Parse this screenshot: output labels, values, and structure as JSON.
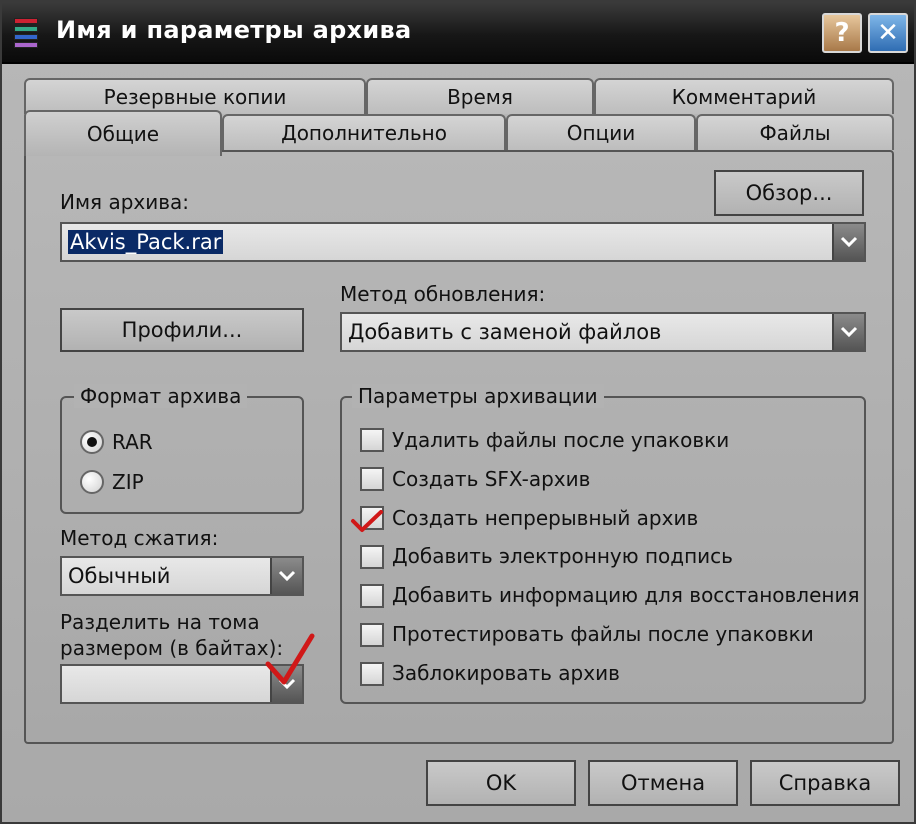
{
  "window": {
    "title": "Имя и параметры архива",
    "help_button": "?",
    "close_button": "✕"
  },
  "tabs_back": [
    "Резервные копии",
    "Время",
    "Комментарий"
  ],
  "tabs_front": [
    "Общие",
    "Дополнительно",
    "Опции",
    "Файлы"
  ],
  "archive_name": {
    "label": "Имя архива:",
    "value": "Akvis_Pack.rar",
    "browse_button": "Обзор..."
  },
  "profiles_button": "Профили...",
  "update_method": {
    "label": "Метод обновления:",
    "value": "Добавить с заменой файлов"
  },
  "archive_format": {
    "title": "Формат архива",
    "options": [
      "RAR",
      "ZIP"
    ],
    "selected": "RAR"
  },
  "compression_method": {
    "label": "Метод сжатия:",
    "value": "Обычный"
  },
  "split_volumes": {
    "label_line1": "Разделить на тома",
    "label_line2": "размером (в байтах):",
    "value": ""
  },
  "archive_options": {
    "title": "Параметры архивации",
    "items": [
      {
        "label": "Удалить файлы после упаковки",
        "checked": false
      },
      {
        "label": "Создать SFX-архив",
        "checked": false
      },
      {
        "label": "Создать непрерывный архив",
        "checked": true
      },
      {
        "label": "Добавить электронную подпись",
        "checked": false
      },
      {
        "label": "Добавить информацию для восстановления",
        "checked": false
      },
      {
        "label": "Протестировать файлы после упаковки",
        "checked": false
      },
      {
        "label": "Заблокировать архив",
        "checked": false
      }
    ]
  },
  "footer": {
    "ok": "OK",
    "cancel": "Отмена",
    "help": "Справка"
  },
  "colors": {
    "check_mark": "#d01818",
    "selection_bg": "#0a2a66"
  }
}
